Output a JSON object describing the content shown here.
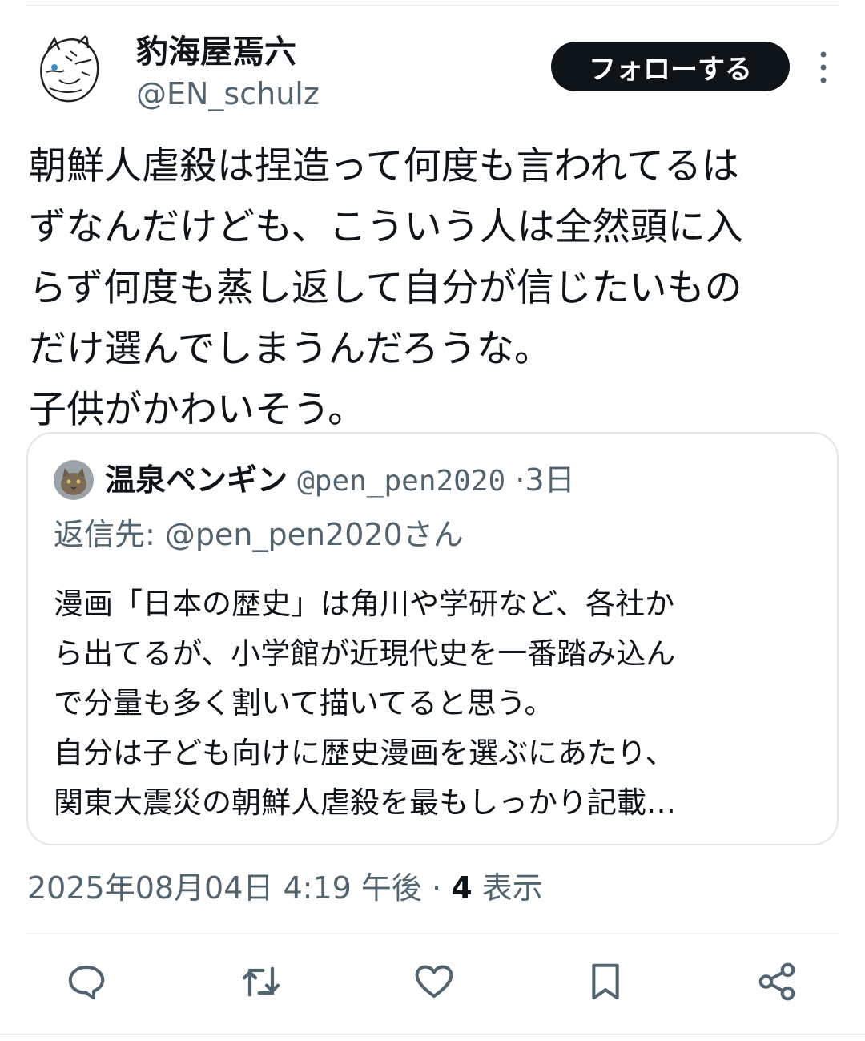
{
  "tweet": {
    "author": {
      "display_name": "豹海屋焉六",
      "handle": "@EN_schulz"
    },
    "follow_label": "フォローする",
    "text": "朝鮮人虐殺は捏造って何度も言われてるは\nずなんだけども、こういう人は全然頭に入\nらず何度も蒸し返して自分が信じたいもの\nだけ選んでしまうんだろうな。\n子供がかわいそう。",
    "quote": {
      "display_name": "温泉ペンギン",
      "handle": "@pen_pen2020",
      "separator": "·",
      "time": "3日",
      "reply_to": "返信先: @pen_pen2020さん",
      "text": "漫画「日本の歴史」は角川や学研など、各社か\nら出てるが、小学館が近現代史を一番踏み込ん\nで分量も多く割いて描いてると思う。\n自分は子ども向けに歴史漫画を選ぶにあたり、\n関東大震災の朝鮮人虐殺を最もしっかり記載…"
    },
    "meta": {
      "timestamp": "2025年08月04日 4:19 午後",
      "separator": "·",
      "view_count": "4",
      "view_label": "表示"
    }
  },
  "actions": {
    "reply_icon": "speech-bubble-icon",
    "retweet_icon": "retweet-icon",
    "like_icon": "heart-icon",
    "bookmark_icon": "bookmark-icon",
    "share_icon": "share-icon"
  },
  "colors": {
    "text_primary": "#0f1419",
    "text_secondary": "#536471",
    "follow_bg": "#0f1419",
    "border": "#e1e5e8"
  }
}
